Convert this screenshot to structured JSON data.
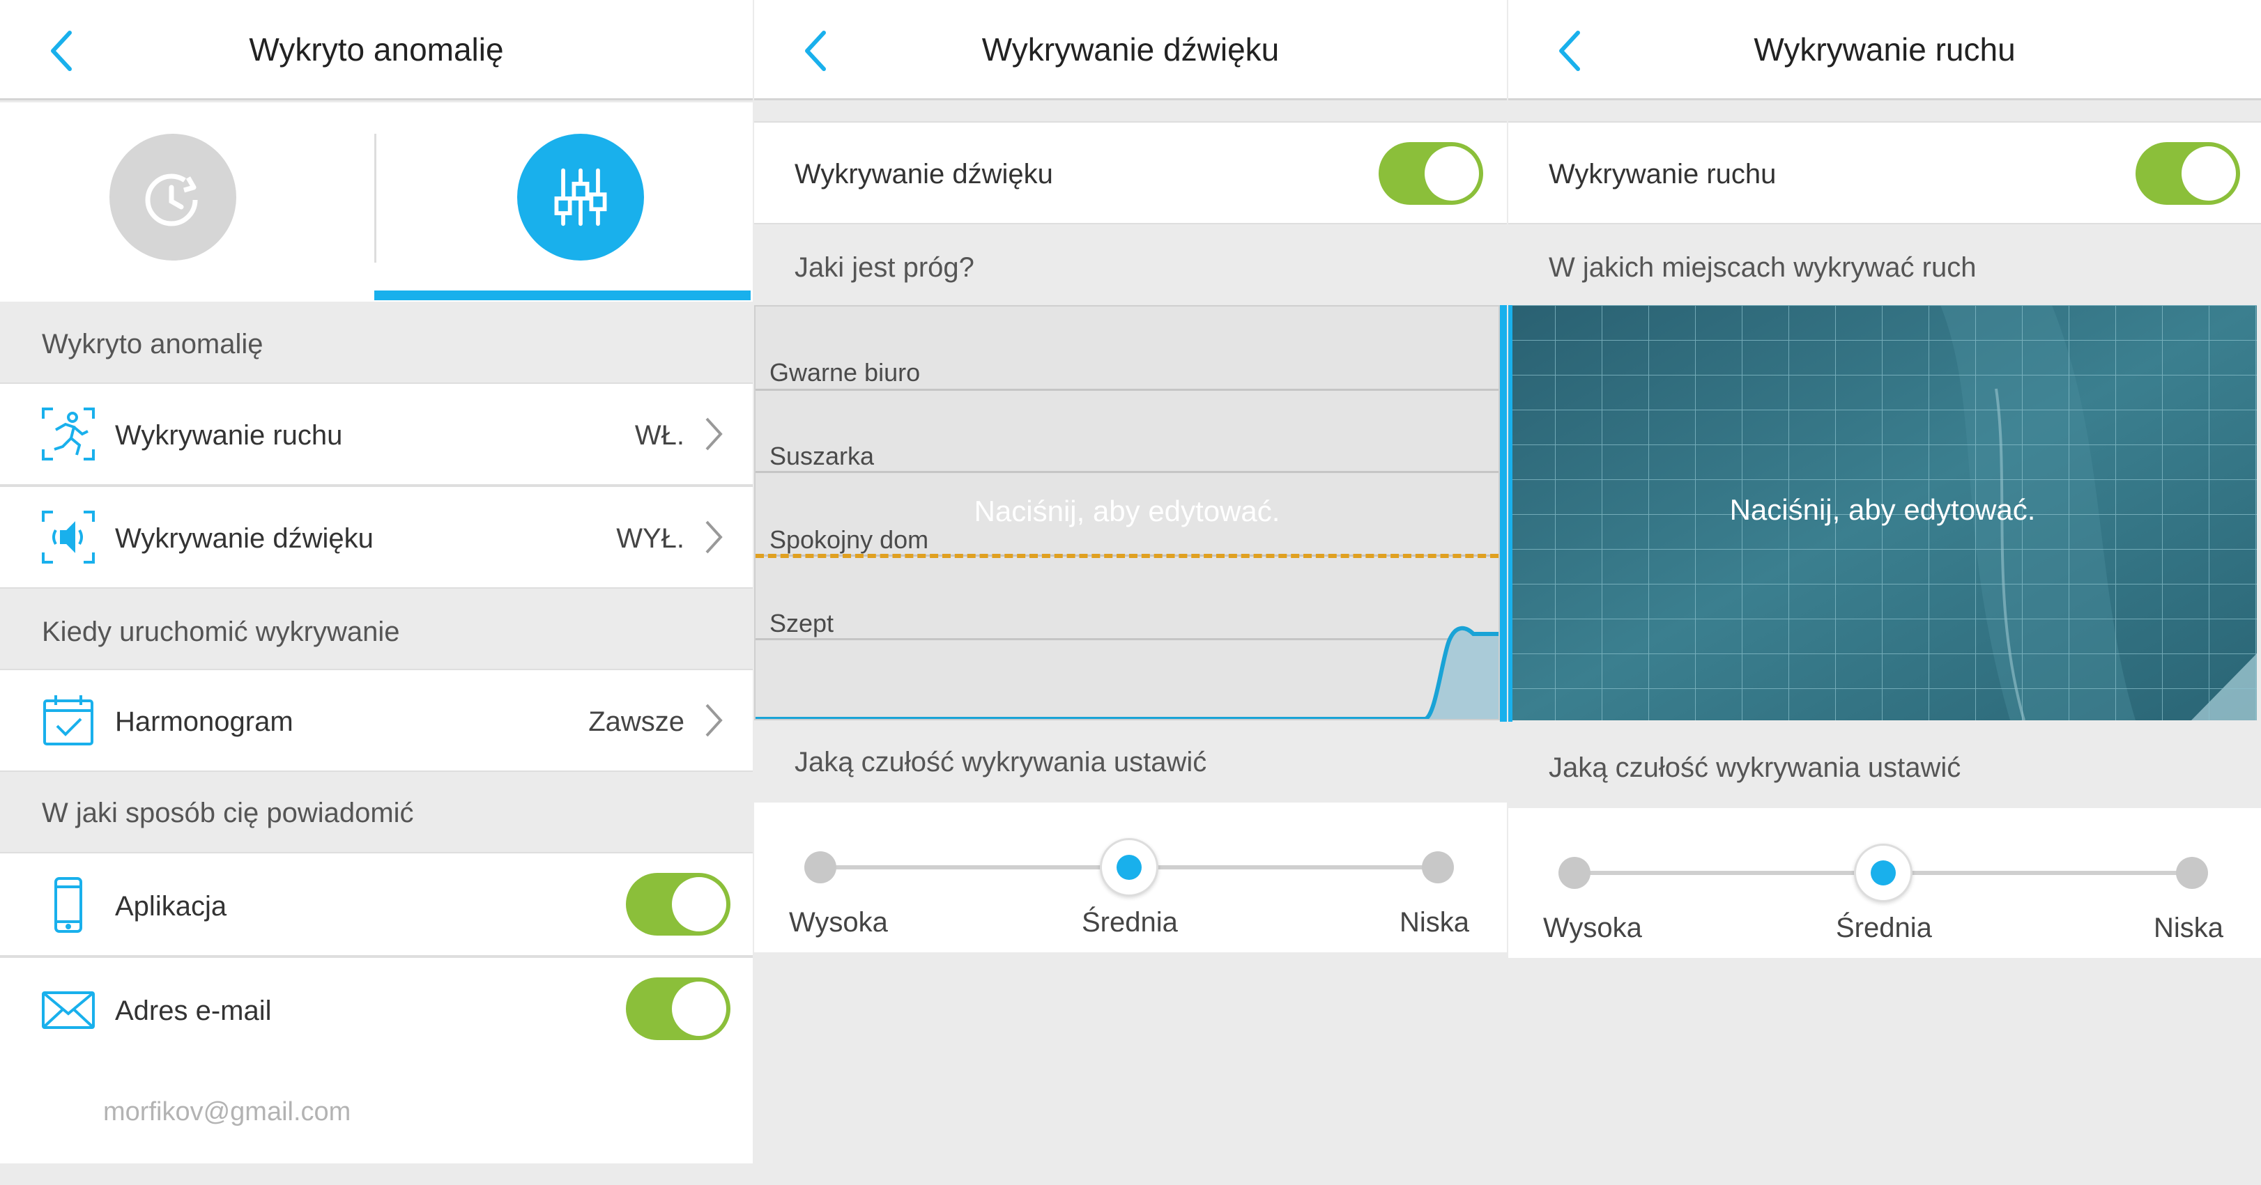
{
  "panel1": {
    "title": "Wykryto anomalię",
    "section_anomaly": "Wykryto anomalię",
    "motion_label": "Wykrywanie ruchu",
    "motion_value": "WŁ.",
    "sound_label": "Wykrywanie dźwięku",
    "sound_value": "WYŁ.",
    "section_when": "Kiedy uruchomić wykrywanie",
    "schedule_label": "Harmonogram",
    "schedule_value": "Zawsze",
    "section_notify": "W jaki sposób cię powiadomić",
    "app_label": "Aplikacja",
    "email_label": "Adres e-mail",
    "email_value": "morfikov@gmail.com",
    "app_toggle_on": true,
    "email_toggle_on": true
  },
  "panel2": {
    "title": "Wykrywanie dźwięku",
    "toggle_label": "Wykrywanie dźwięku",
    "toggle_on": true,
    "threshold_question": "Jaki jest próg?",
    "levels": [
      "Gwarne biuro",
      "Suszarka",
      "Spokojny dom",
      "Szept"
    ],
    "edit_hint": "Naciśnij, aby edytować.",
    "sensitivity_label": "Jaką czułość wykrywania ustawić",
    "sensitivity_options": [
      "Wysoka",
      "Średnia",
      "Niska"
    ],
    "sensitivity_selected": "Średnia"
  },
  "panel3": {
    "title": "Wykrywanie ruchu",
    "toggle_label": "Wykrywanie ruchu",
    "toggle_on": true,
    "areas_label": "W jakich miejscach wykrywać ruch",
    "edit_hint": "Naciśnij, aby edytować.",
    "sensitivity_label": "Jaką czułość wykrywania ustawić",
    "sensitivity_options": [
      "Wysoka",
      "Średnia",
      "Niska"
    ],
    "sensitivity_selected": "Średnia"
  },
  "colors": {
    "accent": "#19b0ec",
    "toggle_on": "#8bbf3a",
    "threshold": "#e0a020",
    "motion_bg": "#2f6e7e"
  }
}
